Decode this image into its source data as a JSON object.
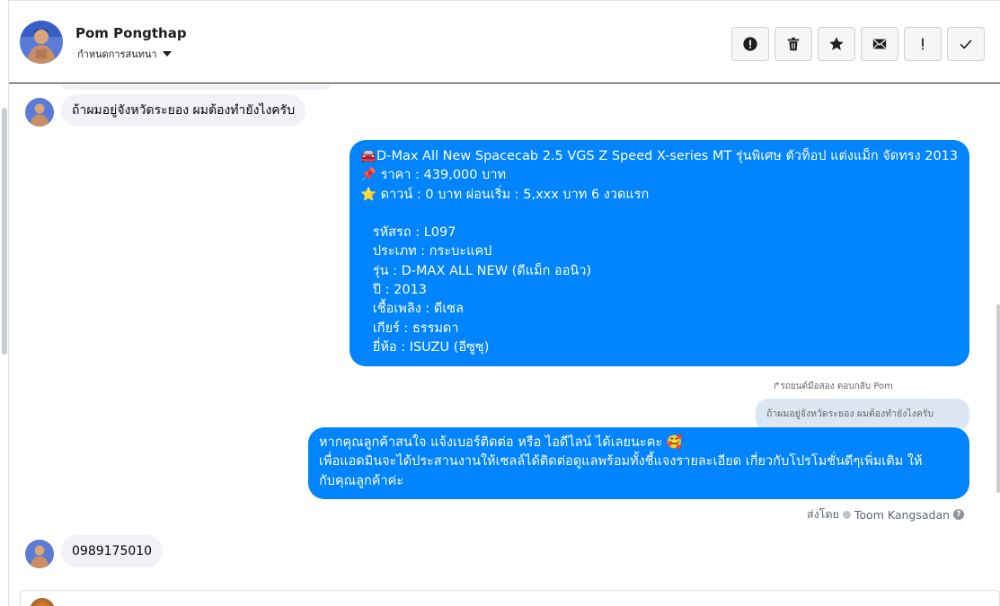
{
  "header": {
    "contact_name": "Pom Pongthap",
    "assign_label": "กำหนดการสนทนา",
    "actions": [
      {
        "name": "report-button",
        "icon": "alert-circle-icon"
      },
      {
        "name": "delete-button",
        "icon": "trash-icon"
      },
      {
        "name": "star-button",
        "icon": "star-icon"
      },
      {
        "name": "mark-unread-button",
        "icon": "envelope-icon"
      },
      {
        "name": "important-button",
        "icon": "exclamation-icon"
      },
      {
        "name": "done-button",
        "icon": "checkmark-icon"
      }
    ]
  },
  "messages": {
    "m1": "ถ้าผมอยู่จังหวัดระยอง ผมต้องทำยังไงครับ",
    "m2": "🚘D-Max All New Spacecab 2.5 VGS Z Speed X-series MT รุ่นพิเศษ ตัวท็อป แต่งแม็ก จัดทรง 2013\n📌 ราคา : 439,000 บาท\n⭐ ดาวน์ : 0 บาท ผ่อนเริ่ม : 5,xxx บาท 6 งวดแรก\n\n   รหัสรถ : L097\n   ประเภท : กระบะแคป\n   รุ่น : D-MAX ALL NEW (ดีแม็ก ออนิว)\n   ปี : 2013\n   เชื้อเพลิง : ดีเซล\n   เกียร์ : ธรรมดา\n   ยี่ห้อ : ISUZU (อีซูซุ)",
    "reply_meta": "↱รถยนต์มือสอง ตอบกลับ Pom",
    "quoted": "ถ้าผมอยู่จังหวัดระยอง ผมต้องทำยังไงครับ",
    "m3": "หากคุณลูกค้าสนใจ แจ้งเบอร์ติดต่อ หรือ ไอดีไลน์ ได้เลยนะคะ 🥰\nเพื่อแอดมินจะได้ประสานงานให้เซลล์ได้ติดต่อดูแลพร้อมทั้งชี้แจงรายละเอียด เกี่ยวกับโปรโมชั่นดีๆเพิ่มเติม ให้\nกับคุณลูกค้าค่ะ",
    "sent_by_label": "ส่งโดย",
    "sent_by_name": "Toom Kangsadan",
    "help_glyph": "?",
    "m4": "0989175010"
  },
  "colors": {
    "outgoing": "#0084ff",
    "incoming": "#f0f2f5",
    "quoted": "#dde6f3"
  }
}
